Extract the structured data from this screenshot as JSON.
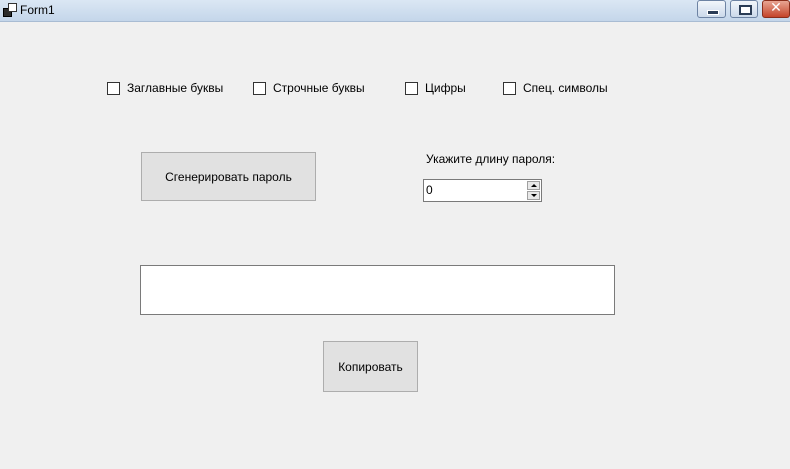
{
  "window": {
    "title": "Form1"
  },
  "checkboxes": [
    {
      "label": "Заглавные буквы",
      "checked": false
    },
    {
      "label": "Строчные буквы",
      "checked": false
    },
    {
      "label": "Цифры",
      "checked": false
    },
    {
      "label": "Спец. символы",
      "checked": false
    }
  ],
  "generate_button": {
    "label": "Сгенерировать пароль"
  },
  "length": {
    "label": "Укажите длину пароля:",
    "value": "0"
  },
  "output": {
    "value": ""
  },
  "copy_button": {
    "label": "Копировать"
  }
}
